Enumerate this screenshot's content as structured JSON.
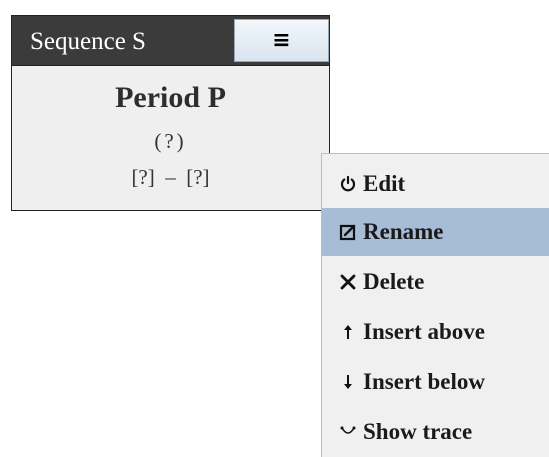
{
  "sequence": {
    "title": "Sequence S",
    "menu_button_glyph": "≡"
  },
  "period": {
    "name": "Period P",
    "count": "(?)",
    "range": "[?]  –  [?]"
  },
  "context_menu": {
    "items": [
      {
        "label": "Edit",
        "icon": "power-icon"
      },
      {
        "label": "Rename",
        "icon": "edit-box-icon",
        "highlighted": true
      },
      {
        "label": "Delete",
        "icon": "close-icon"
      },
      {
        "label": "Insert above",
        "icon": "arrow-up-icon"
      },
      {
        "label": "Insert below",
        "icon": "arrow-down-icon"
      },
      {
        "label": "Show trace",
        "icon": "trace-icon"
      }
    ]
  },
  "colors": {
    "header_bg": "#3b3b3b",
    "highlight": "#a7bcd6"
  }
}
